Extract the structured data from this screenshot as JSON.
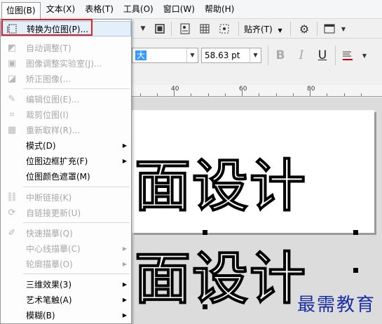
{
  "menubar": {
    "items": [
      {
        "label": "位图(B)"
      },
      {
        "label": "文本(X)"
      },
      {
        "label": "表格(T)"
      },
      {
        "label": "工具(O)"
      },
      {
        "label": "窗口(W)"
      },
      {
        "label": "帮助(H)"
      }
    ]
  },
  "toolbar": {
    "snap_label": "贴齐(T)",
    "font_name_fragment": "大",
    "font_size": "58.63 pt",
    "bold": "B",
    "italic": "I",
    "underline": "U"
  },
  "ruler": {
    "labels": [
      "40",
      "60",
      "80"
    ]
  },
  "bitmap_menu": {
    "items": [
      {
        "label": "转换为位图(P)...",
        "enabled": true,
        "icon": "convert-bitmap-icon",
        "highlighted": true
      },
      {
        "label": "自动调整(T)",
        "enabled": false,
        "icon": "auto-adjust-icon"
      },
      {
        "label": "图像调整实验室(J)...",
        "enabled": false,
        "icon": "image-lab-icon"
      },
      {
        "label": "矫正图像(...",
        "enabled": false,
        "icon": "straighten-icon"
      },
      {
        "label": "编辑位图(E)...",
        "enabled": false,
        "icon": "edit-bitmap-icon"
      },
      {
        "label": "裁剪位图(I)",
        "enabled": false,
        "icon": "crop-bitmap-icon"
      },
      {
        "label": "重新取样(R)...",
        "enabled": false,
        "icon": "resample-icon"
      },
      {
        "label": "模式(D)",
        "enabled": true,
        "submenu": true
      },
      {
        "label": "位图边框扩充(F)",
        "enabled": true,
        "submenu": true
      },
      {
        "label": "位图颜色遮罩(M)",
        "enabled": true
      },
      {
        "label": "中断链接(K)",
        "enabled": false,
        "icon": "break-link-icon"
      },
      {
        "label": "自链接更新(U)",
        "enabled": false,
        "icon": "update-link-icon"
      },
      {
        "label": "快速描摹(Q)",
        "enabled": false,
        "icon": "quick-trace-icon"
      },
      {
        "label": "中心线描摹(C)",
        "enabled": false,
        "submenu": true
      },
      {
        "label": "轮廓描摹(O)",
        "enabled": false,
        "submenu": true
      },
      {
        "label": "三维效果(3)",
        "enabled": true,
        "submenu": true
      },
      {
        "label": "艺术笔触(A)",
        "enabled": true,
        "submenu": true
      },
      {
        "label": "模糊(B)",
        "enabled": true,
        "submenu": true
      }
    ]
  },
  "canvas": {
    "text_line_1": "面设计",
    "text_line_2": "面设计"
  },
  "watermark": "最需教育",
  "colors": {
    "highlight_border": "#e02020",
    "watermark": "#1a2ea8"
  }
}
